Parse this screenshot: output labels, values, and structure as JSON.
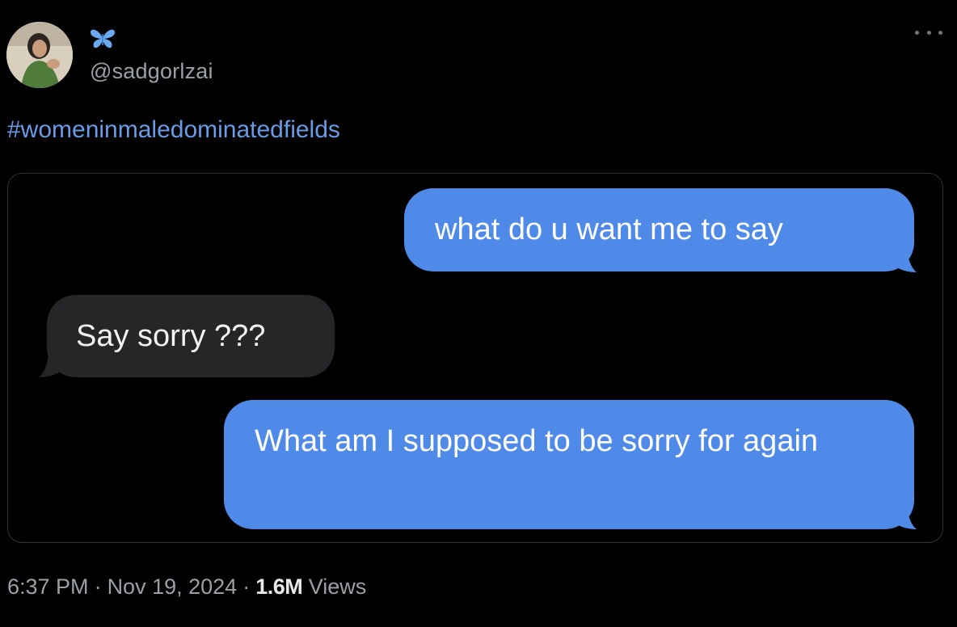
{
  "author": {
    "handle": "@sadgorlzai"
  },
  "post": {
    "hashtag": "#womeninmaledominatedfields",
    "messages": [
      {
        "side": "sent",
        "text": "what do u want me to say"
      },
      {
        "side": "received",
        "text": "Say sorry ???"
      },
      {
        "side": "sent",
        "text": "What am I supposed to be sorry for again"
      }
    ]
  },
  "meta": {
    "time": "6:37 PM",
    "separator": "·",
    "date": "Nov 19, 2024",
    "views_count": "1.6M",
    "views_label": "Views"
  },
  "colors": {
    "background": "#000000",
    "link": "#6a9be6",
    "sent_bubble": "#4f8ae8",
    "received_bubble": "#262628",
    "muted_text": "#9aa0a6",
    "butterfly": "#6aa8f0"
  },
  "icons": {
    "butterfly": "butterfly-icon",
    "more": "more-options-icon"
  }
}
